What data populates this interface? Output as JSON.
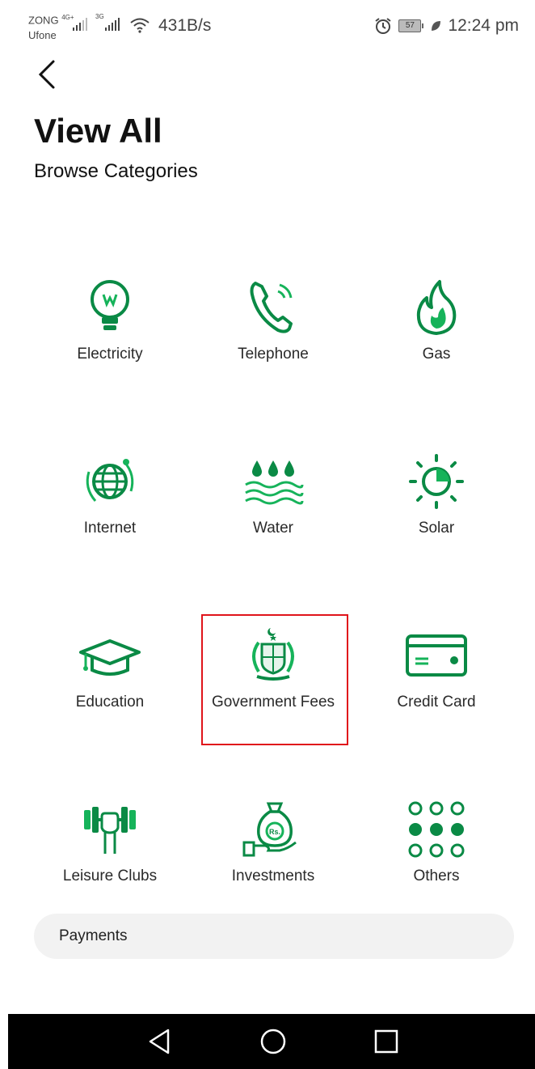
{
  "status_bar": {
    "carrier_1": "ZONG",
    "carrier_2": "Ufone",
    "net_1": "4G+",
    "net_2": "3G",
    "net_speed": "431B/s",
    "battery": "57",
    "time": "12:24 pm"
  },
  "header": {
    "title": "View All",
    "subtitle": "Browse Categories"
  },
  "categories": [
    {
      "label": "Electricity",
      "icon": "lightbulb-icon"
    },
    {
      "label": "Telephone",
      "icon": "telephone-icon"
    },
    {
      "label": "Gas",
      "icon": "flame-icon"
    },
    {
      "label": "Internet",
      "icon": "globe-icon"
    },
    {
      "label": "Water",
      "icon": "water-drops-icon"
    },
    {
      "label": "Solar",
      "icon": "sun-icon"
    },
    {
      "label": "Education",
      "icon": "graduation-cap-icon"
    },
    {
      "label": "Government Fees",
      "icon": "government-emblem-icon"
    },
    {
      "label": "Credit Card",
      "icon": "credit-card-icon"
    },
    {
      "label": "Leisure Clubs",
      "icon": "dumbbell-icon"
    },
    {
      "label": "Investments",
      "icon": "money-bag-icon"
    },
    {
      "label": "Others",
      "icon": "dots-grid-icon"
    }
  ],
  "payments": {
    "label": "Payments"
  },
  "colors": {
    "icon_green": "#0a8a45",
    "icon_light_green": "#16b35a",
    "highlight_red": "#e0141b"
  }
}
